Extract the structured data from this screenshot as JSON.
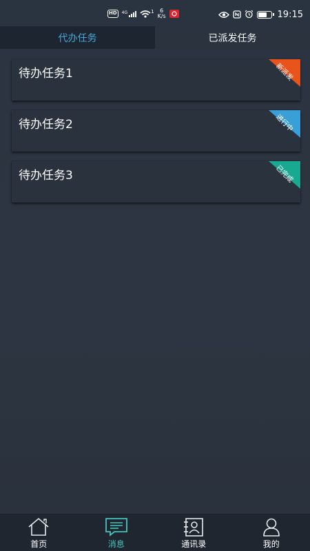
{
  "status_bar": {
    "hd": "HD",
    "net_small": "4G",
    "wifi_sup": "1",
    "speed_value": "6",
    "speed_unit": "K/s",
    "time": "19:15",
    "battery_level": 0.75
  },
  "tabs": [
    {
      "label": "代办任务",
      "active": true
    },
    {
      "label": "已派发任务",
      "active": false
    }
  ],
  "tasks": [
    {
      "title": "待办任务1",
      "badge": "新派发",
      "badge_color": "#e8541c"
    },
    {
      "title": "待办任务2",
      "badge": "进行中",
      "badge_color": "#3a9fd6"
    },
    {
      "title": "待办任务3",
      "badge": "已完成",
      "badge_color": "#19a890"
    }
  ],
  "bottom_nav": [
    {
      "label": "首页",
      "icon": "home-icon",
      "active": false
    },
    {
      "label": "消息",
      "icon": "message-icon",
      "active": true
    },
    {
      "label": "通讯录",
      "icon": "contacts-icon",
      "active": false
    },
    {
      "label": "我的",
      "icon": "profile-icon",
      "active": false
    }
  ],
  "colors": {
    "accent": "#46a8d8",
    "nav_active": "#46c6c0",
    "background": "#2b3440"
  }
}
